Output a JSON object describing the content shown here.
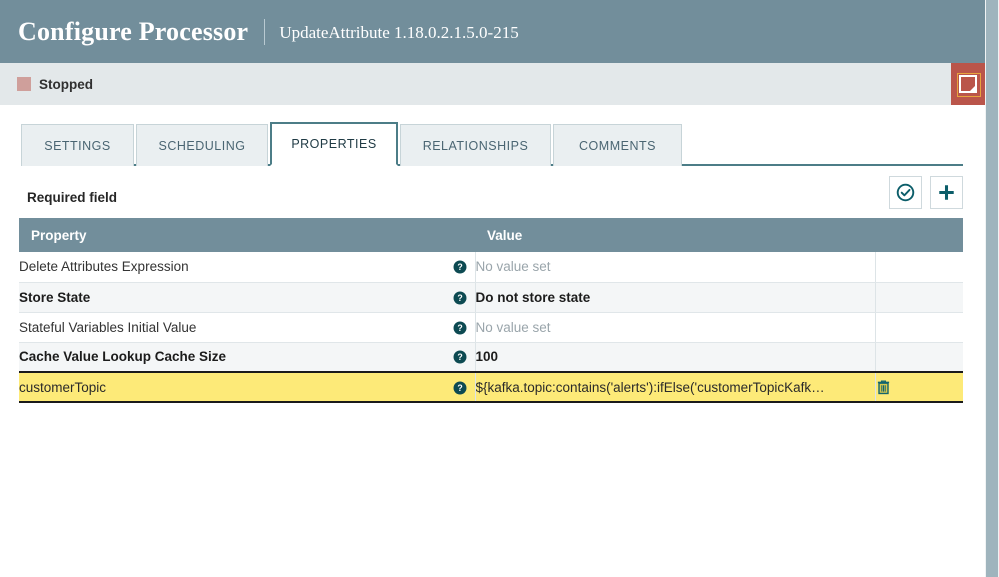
{
  "header": {
    "title": "Configure Processor",
    "subtitle": "UpdateAttribute 1.18.0.2.1.5.0-215",
    "background_color": "#728e9b"
  },
  "status": {
    "label": "Stopped",
    "indicator_color": "#cf9f9b",
    "note_button_color": "#ba554a",
    "note_icon": "note-icon"
  },
  "tabs": [
    {
      "label": "SETTINGS",
      "active": false
    },
    {
      "label": "SCHEDULING",
      "active": false
    },
    {
      "label": "PROPERTIES",
      "active": true
    },
    {
      "label": "RELATIONSHIPS",
      "active": false
    },
    {
      "label": "COMMENTS",
      "active": false
    }
  ],
  "toolbar": {
    "required_field_label": "Required field",
    "verify_button_icon": "check-circle-icon",
    "add_button_icon": "plus-icon",
    "accent_color": "#0b5d69"
  },
  "table": {
    "columns": [
      "Property",
      "Value"
    ],
    "header_background": "#728e9b",
    "help_icon": "question-circle-icon",
    "delete_icon": "trash-icon",
    "selected_row_color": "#fdea78",
    "rows": [
      {
        "property": "Delete Attributes Expression",
        "value": "No value set",
        "value_is_placeholder": true,
        "required": false,
        "selected": false,
        "deletable": false
      },
      {
        "property": "Store State",
        "value": "Do not store state",
        "value_is_placeholder": false,
        "required": true,
        "selected": false,
        "deletable": false
      },
      {
        "property": "Stateful Variables Initial Value",
        "value": "No value set",
        "value_is_placeholder": true,
        "required": false,
        "selected": false,
        "deletable": false
      },
      {
        "property": "Cache Value Lookup Cache Size",
        "value": "100",
        "value_is_placeholder": false,
        "required": true,
        "selected": false,
        "deletable": false
      },
      {
        "property": "customerTopic",
        "value": "${kafka.topic:contains('alerts'):ifElse('customerTopicKafk…",
        "value_is_placeholder": false,
        "required": false,
        "selected": true,
        "deletable": true
      }
    ]
  },
  "scrollbar": {
    "thumb_color": "#9fb4bd"
  }
}
